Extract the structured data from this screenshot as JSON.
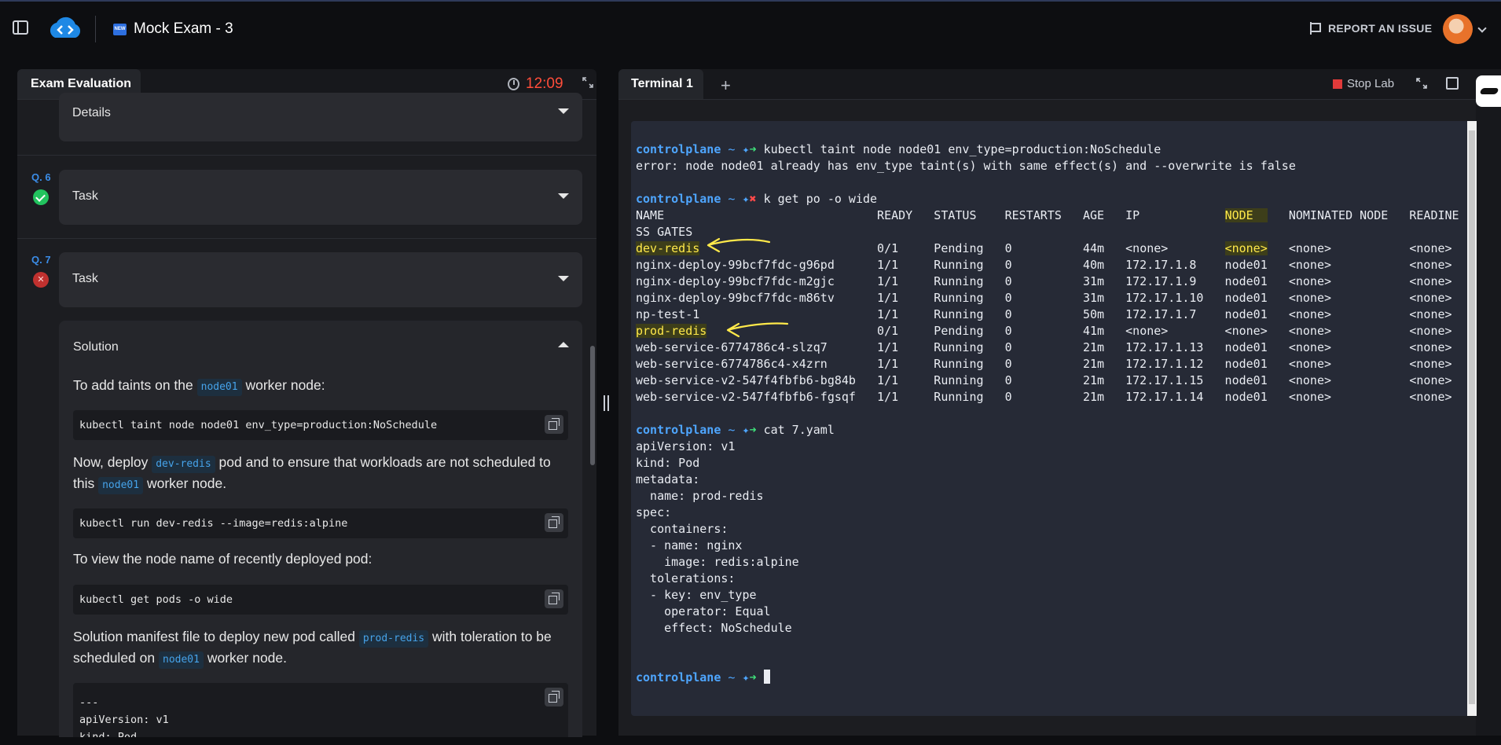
{
  "header": {
    "exam_title": "Mock Exam - 3",
    "badge": "NEW",
    "report_label": "REPORT AN ISSUE"
  },
  "left_panel": {
    "tab_label": "Exam Evaluation",
    "timer": "12:09",
    "details_label": "Details",
    "q6": {
      "number": "Q. 6",
      "label": "Task",
      "status": "correct"
    },
    "q7": {
      "number": "Q. 7",
      "label": "Task",
      "status": "incorrect",
      "status_glyph": "✕"
    },
    "solution": {
      "label": "Solution",
      "p1_before": "To add taints on the",
      "p1_code": "node01",
      "p1_after": "worker node:",
      "code1": "kubectl taint node node01 env_type=production:NoSchedule",
      "p2_before": "Now, deploy",
      "p2_code1": "dev-redis",
      "p2_mid": "pod and to ensure that workloads are not scheduled to this",
      "p2_code2": "node01",
      "p2_after": "worker node.",
      "code2": "kubectl run dev-redis --image=redis:alpine",
      "p3": "To view the node name of recently deployed pod:",
      "code3": "kubectl get pods -o wide",
      "p4_before": "Solution manifest file to deploy new pod called",
      "p4_code1": "prod-redis",
      "p4_mid": "with toleration to be scheduled on",
      "p4_code2": "node01",
      "p4_after": "worker node.",
      "code4_l1": "---",
      "code4_l2": "apiVersion: v1",
      "code4_l3": "kind: Pod"
    }
  },
  "right_panel": {
    "tab_label": "Terminal 1",
    "add_tab": "+",
    "stop_label": "Stop Lab"
  },
  "terminal": {
    "host": "controlplane",
    "tilde": "~",
    "star": "✦",
    "ok": "➜",
    "fail": "✖",
    "cmd1": "kubectl taint node node01 env_type=production:NoSchedule",
    "out1": "error: node node01 already has env_type taint(s) with same effect(s) and --overwrite is false",
    "cmd2": "k get po -o wide",
    "hdr_a": "NAME                              READY   STATUS    RESTARTS   AGE   IP            ",
    "hdr_node": "NODE  ",
    "hdr_b": "   NOMINATED NODE   READINE",
    "hdr2": "SS GATES",
    "row_dev_name": "dev-redis",
    "row_dev_a": "                         0/1     Pending   0          44m   <none>        ",
    "row_dev_node": "<none>",
    "row_dev_b": "   <none>           <none>",
    "rows": [
      "nginx-deploy-99bcf7fdc-g96pd      1/1     Running   0          40m   172.17.1.8    node01   <none>           <none>",
      "nginx-deploy-99bcf7fdc-m2gjc      1/1     Running   0          31m   172.17.1.9    node01   <none>           <none>",
      "nginx-deploy-99bcf7fdc-m86tv      1/1     Running   0          31m   172.17.1.10   node01   <none>           <none>",
      "np-test-1                         1/1     Running   0          50m   172.17.1.7    node01   <none>           <none>"
    ],
    "row_prod_name": "prod-redis",
    "row_prod_rest": "                        0/1     Pending   0          41m   <none>        <none>   <none>           <none>",
    "rows2": [
      "web-service-6774786c4-slzq7       1/1     Running   0          21m   172.17.1.13   node01   <none>           <none>",
      "web-service-6774786c4-x4zrn       1/1     Running   0          21m   172.17.1.12   node01   <none>           <none>",
      "web-service-v2-547f4fbfb6-bg84b   1/1     Running   0          21m   172.17.1.15   node01   <none>           <none>",
      "web-service-v2-547f4fbfb6-fgsqf   1/1     Running   0          21m   172.17.1.14   node01   <none>           <none>"
    ],
    "cmd3": "cat 7.yaml",
    "yaml": [
      "apiVersion: v1",
      "kind: Pod",
      "metadata:",
      "  name: prod-redis",
      "spec:",
      "  containers:",
      "  - name: nginx",
      "    image: redis:alpine",
      "  tolerations:",
      "  - key: env_type",
      "    operator: Equal",
      "    effect: NoSchedule"
    ]
  },
  "colors": {
    "accent_blue": "#3b8de8",
    "timer_red": "#ff4d3a",
    "prompt_host": "#4ea6ff",
    "prompt_ok": "#3fe07a",
    "prompt_fail": "#ff4a4a",
    "highlight": "#ffe94a"
  }
}
